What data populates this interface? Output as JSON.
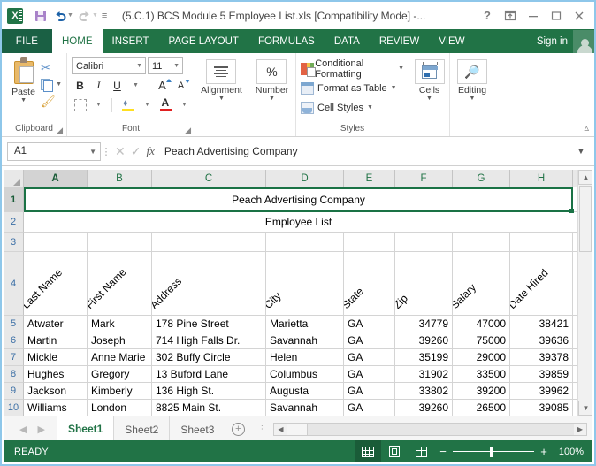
{
  "window": {
    "title": "(5.C.1) BCS Module 5 Employee List.xls  [Compatibility Mode] -...",
    "help_icon": "?",
    "ribbon_display_icon": "ribbon-display-options",
    "minimize_icon": "minimize",
    "restore_icon": "restore",
    "close_icon": "close"
  },
  "quick_access": {
    "save": "save-icon",
    "undo": "undo-icon",
    "redo": "redo-icon",
    "customize": "customize-qat-icon"
  },
  "tabs": {
    "file": "FILE",
    "items": [
      {
        "label": "HOME",
        "active": true
      },
      {
        "label": "INSERT",
        "active": false
      },
      {
        "label": "PAGE LAYOUT",
        "active": false
      },
      {
        "label": "FORMULAS",
        "active": false
      },
      {
        "label": "DATA",
        "active": false
      },
      {
        "label": "REVIEW",
        "active": false
      },
      {
        "label": "VIEW",
        "active": false
      }
    ],
    "sign_in": "Sign in"
  },
  "ribbon": {
    "clipboard": {
      "group_label": "Clipboard",
      "paste_label": "Paste",
      "cut_label": "",
      "copy_label": "",
      "format_painter_label": ""
    },
    "font": {
      "group_label": "Font",
      "font_name": "Calibri",
      "font_size": "11",
      "bold": "B",
      "italic": "I",
      "underline": "U",
      "grow_font": "A",
      "shrink_font": "A"
    },
    "alignment": {
      "group_label": "Alignment",
      "label": "Alignment"
    },
    "number": {
      "group_label": "Number",
      "label": "Number",
      "symbol": "%"
    },
    "styles": {
      "group_label": "Styles",
      "conditional_formatting": "Conditional Formatting",
      "format_as_table": "Format as Table",
      "cell_styles": "Cell Styles"
    },
    "cells": {
      "label": "Cells"
    },
    "editing": {
      "label": "Editing"
    }
  },
  "formula_bar": {
    "name_box": "A1",
    "cancel_icon": "cancel-icon",
    "enter_icon": "enter-icon",
    "function_icon": "insert-function-icon",
    "content": "Peach Advertising Company"
  },
  "grid": {
    "columns": [
      "A",
      "B",
      "C",
      "D",
      "E",
      "F",
      "G",
      "H"
    ],
    "rows": [
      "1",
      "2",
      "3",
      "4",
      "5",
      "6",
      "7",
      "8",
      "9",
      "10"
    ],
    "selected_cell": "A1",
    "title_row": "Peach Advertising Company",
    "subtitle_row": "Employee List",
    "headers": [
      "Last Name",
      "First Name",
      "Address",
      "City",
      "State",
      "Zip",
      "Salary",
      "Date Hired"
    ],
    "data": [
      [
        "Atwater",
        "Mark",
        "178 Pine Street",
        "Marietta",
        "GA",
        "34779",
        "47000",
        "38421"
      ],
      [
        "Martin",
        "Joseph",
        "714 High Falls Dr.",
        "Savannah",
        "GA",
        "39260",
        "75000",
        "39636"
      ],
      [
        "Mickle",
        "Anne Marie",
        "302 Buffy Circle",
        "Helen",
        "GA",
        "35199",
        "29000",
        "39378"
      ],
      [
        "Hughes",
        "Gregory",
        "13 Buford Lane",
        "Columbus",
        "GA",
        "31902",
        "33500",
        "39859"
      ],
      [
        "Jackson",
        "Kimberly",
        "136 High St.",
        "Augusta",
        "GA",
        "33802",
        "39200",
        "39962"
      ],
      [
        "Williams",
        "London",
        "8825 Main St.",
        "Savannah",
        "GA",
        "39260",
        "26500",
        "39085"
      ]
    ]
  },
  "sheet_tabs": {
    "prev_icon": "previous-sheet-icon",
    "next_icon": "next-sheet-icon",
    "tabs": [
      {
        "label": "Sheet1",
        "active": true
      },
      {
        "label": "Sheet2",
        "active": false
      },
      {
        "label": "Sheet3",
        "active": false
      }
    ],
    "add_sheet": "+"
  },
  "status_bar": {
    "mode": "READY",
    "view_normal": "normal-view-icon",
    "view_page_layout": "page-layout-view-icon",
    "view_page_break": "page-break-preview-icon",
    "zoom_out": "−",
    "zoom_in": "+",
    "zoom_level": "100%"
  },
  "colors": {
    "accent_green": "#217346",
    "title_bar": "#ffffff",
    "header_gray": "#e8e8e8"
  }
}
